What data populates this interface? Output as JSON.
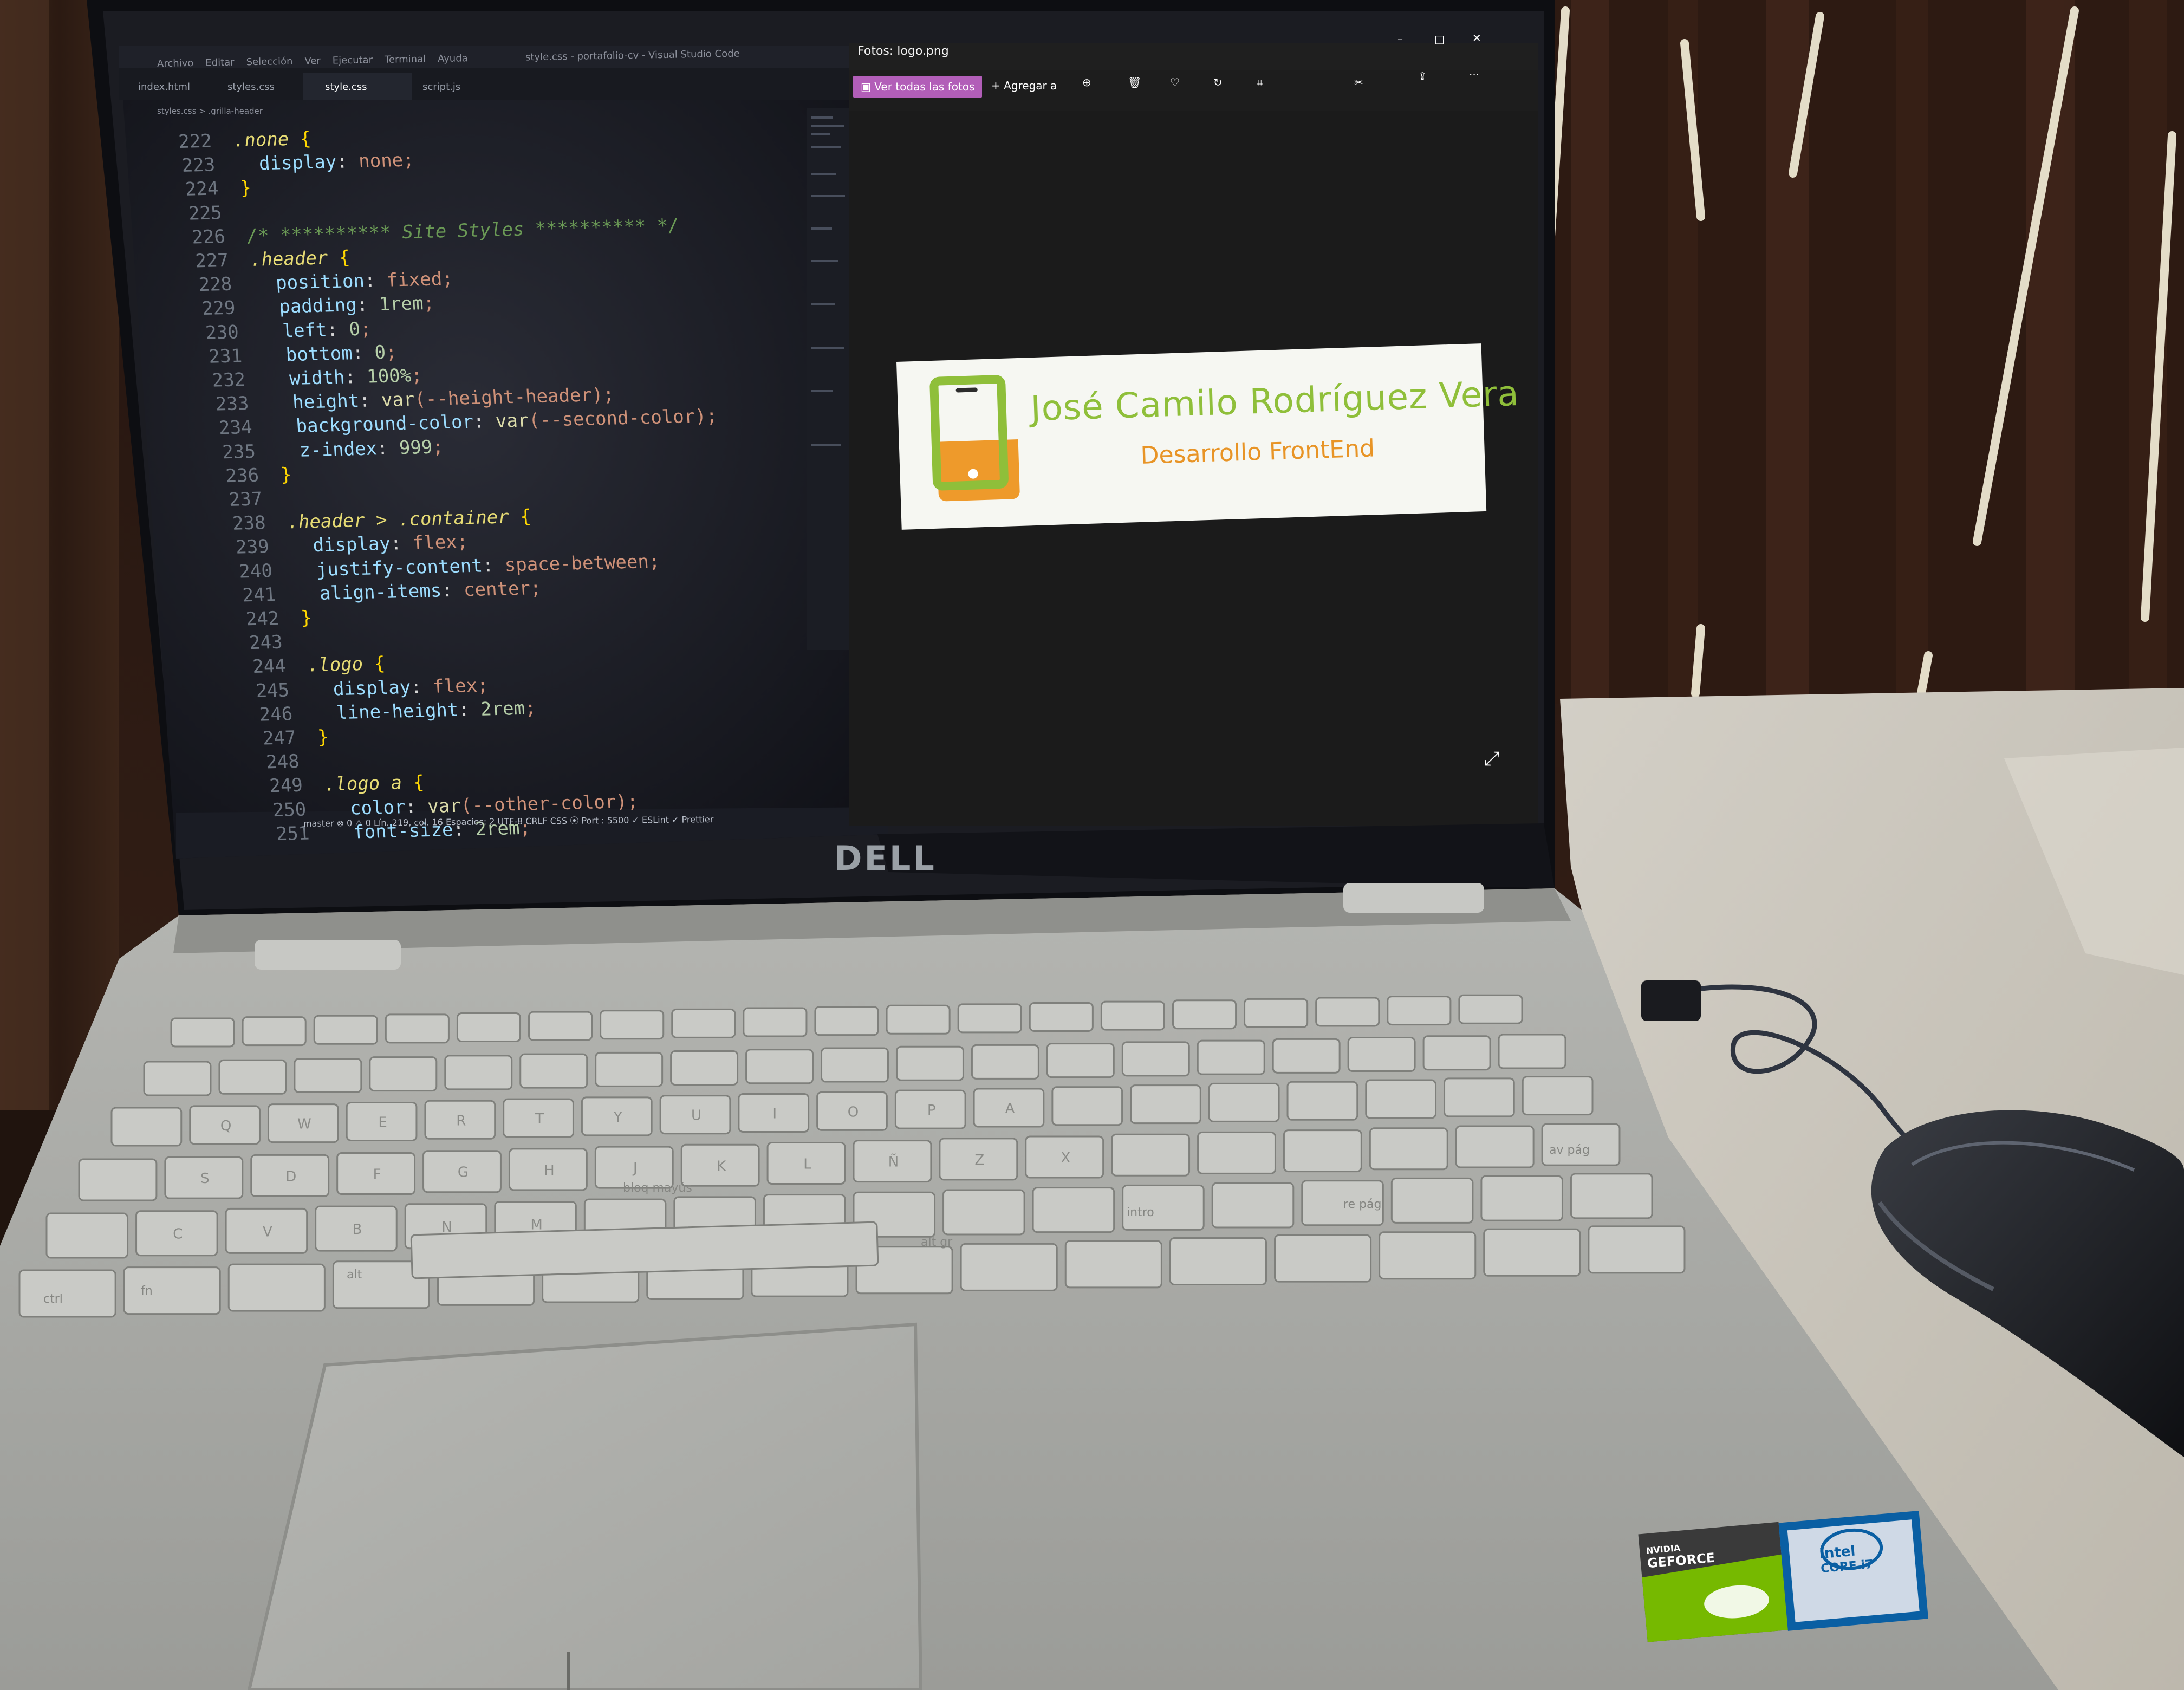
{
  "vscode": {
    "title": "style.css - portafolio-cv - Visual Studio Code",
    "menu": [
      "Archivo",
      "Editar",
      "Selección",
      "Ver",
      "Ejecutar",
      "Terminal",
      "Ayuda"
    ],
    "tabs": [
      "index.html",
      "styles.css",
      "style.css",
      "script.js"
    ],
    "active_tab": "style.css",
    "breadcrumb": "styles.css > .grilla-header",
    "code_lines": [
      {
        "n": "222",
        "text": ".none {"
      },
      {
        "n": "223",
        "text": "  display: none;"
      },
      {
        "n": "224",
        "text": "}"
      },
      {
        "n": "225",
        "text": ""
      },
      {
        "n": "226",
        "text": "/* ********** Site Styles ********** */"
      },
      {
        "n": "227",
        "text": ".header {"
      },
      {
        "n": "228",
        "text": "  position: fixed;"
      },
      {
        "n": "229",
        "text": "  padding: 1rem;"
      },
      {
        "n": "230",
        "text": "  left: 0;"
      },
      {
        "n": "231",
        "text": "  bottom: 0;"
      },
      {
        "n": "232",
        "text": "  width: 100%;"
      },
      {
        "n": "233",
        "text": "  height: var(--height-header);"
      },
      {
        "n": "234",
        "text": "  background-color: var(--second-color);"
      },
      {
        "n": "235",
        "text": "  z-index: 999;"
      },
      {
        "n": "236",
        "text": "}"
      },
      {
        "n": "237",
        "text": ""
      },
      {
        "n": "238",
        "text": ".header > .container {"
      },
      {
        "n": "239",
        "text": "  display: flex;"
      },
      {
        "n": "240",
        "text": "  justify-content: space-between;"
      },
      {
        "n": "241",
        "text": "  align-items: center;"
      },
      {
        "n": "242",
        "text": "}"
      },
      {
        "n": "243",
        "text": ""
      },
      {
        "n": "244",
        "text": ".logo {"
      },
      {
        "n": "245",
        "text": "  display: flex;"
      },
      {
        "n": "246",
        "text": "  line-height: 2rem;"
      },
      {
        "n": "247",
        "text": "}"
      },
      {
        "n": "248",
        "text": ""
      },
      {
        "n": "249",
        "text": ".logo a {"
      },
      {
        "n": "250",
        "text": "  color: var(--other-color);"
      },
      {
        "n": "251",
        "text": "  font-size: 2rem;"
      }
    ],
    "status": "master  ⊗ 0 ⚠ 0    Lín. 219, col. 16   Espacios: 2   UTF-8   CRLF   CSS   ⦿ Port : 5500   ✓ ESLint   ✓ Prettier"
  },
  "photos": {
    "title": "Fotos: logo.png",
    "see_all_label": "Ver todas las fotos",
    "add_to_label": "Agregar a",
    "more_label": "···",
    "logo_name": "José Camilo Rodríguez Vera",
    "logo_subtitle": "Desarrollo FrontEnd"
  },
  "hardware": {
    "brand": "DELL",
    "sticker_nvidia": "GEFORCE",
    "sticker_nvidia_top": "NVIDIA",
    "sticker_intel": "intel",
    "sticker_intel_core": "CORE i7"
  },
  "keyboard": {
    "labels": [
      "Q",
      "W",
      "E",
      "R",
      "T",
      "Y",
      "U",
      "I",
      "O",
      "P",
      "A",
      "S",
      "D",
      "F",
      "G",
      "H",
      "J",
      "K",
      "L",
      "Ñ",
      "Z",
      "X",
      "C",
      "V",
      "B",
      "N",
      "M",
      "ctrl",
      "fn",
      "alt",
      "alt gr",
      "bloq mayús",
      "intro",
      "re pág",
      "av pág"
    ]
  },
  "colors": {
    "code_bg": "#14161c",
    "photos_bg": "#1b1b1b",
    "accent": "#b25eb8",
    "logo_green": "#8fbf3a",
    "logo_orange": "#e89426",
    "laptop_silver": "#a9aaa6"
  }
}
